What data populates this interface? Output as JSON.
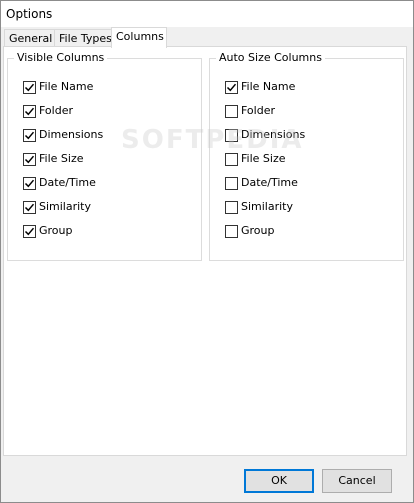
{
  "window": {
    "title": "Options"
  },
  "tabs": [
    {
      "label": "General",
      "active": false
    },
    {
      "label": "File Types",
      "active": false
    },
    {
      "label": "Columns",
      "active": true
    }
  ],
  "visible_columns": {
    "legend": "Visible Columns",
    "items": [
      {
        "label": "File Name",
        "checked": true
      },
      {
        "label": "Folder",
        "checked": true
      },
      {
        "label": "Dimensions",
        "checked": true
      },
      {
        "label": "File Size",
        "checked": true
      },
      {
        "label": "Date/Time",
        "checked": true
      },
      {
        "label": "Similarity",
        "checked": true
      },
      {
        "label": "Group",
        "checked": true
      }
    ]
  },
  "auto_size_columns": {
    "legend": "Auto Size Columns",
    "items": [
      {
        "label": "File Name",
        "checked": true
      },
      {
        "label": "Folder",
        "checked": false
      },
      {
        "label": "Dimensions",
        "checked": false
      },
      {
        "label": "File Size",
        "checked": false
      },
      {
        "label": "Date/Time",
        "checked": false
      },
      {
        "label": "Similarity",
        "checked": false
      },
      {
        "label": "Group",
        "checked": false
      }
    ]
  },
  "buttons": {
    "ok": "OK",
    "cancel": "Cancel"
  },
  "watermark": "SOFTPEDIA",
  "colors": {
    "accent": "#0078d7",
    "window_bg": "#f0f0f0",
    "panel_bg": "#ffffff",
    "border": "#d9d9d9"
  }
}
